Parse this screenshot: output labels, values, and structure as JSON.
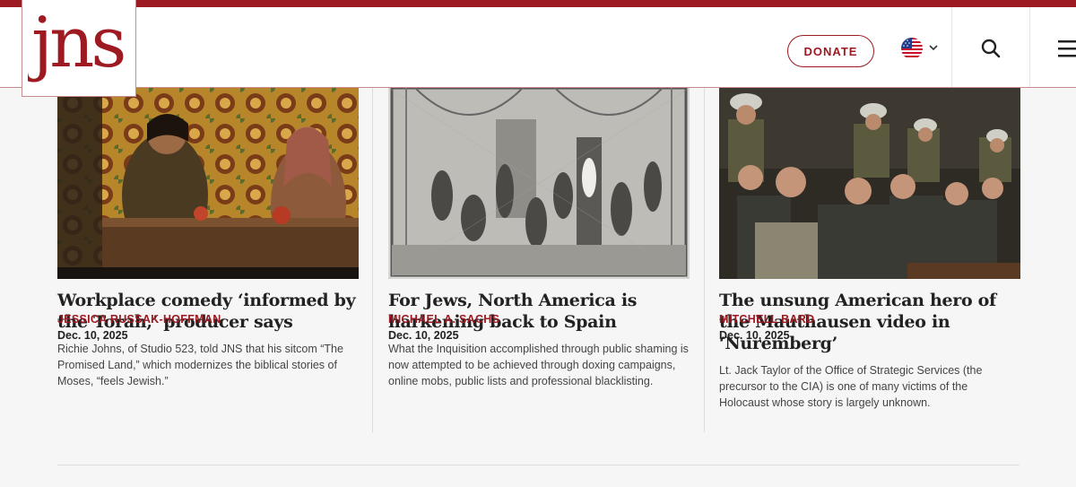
{
  "brand": {
    "logo_text": "jns",
    "accent_color": "#9e1a22"
  },
  "header": {
    "donate_label": "DONATE",
    "language_flag": "us-flag-icon",
    "icons": [
      "chevron-down-icon",
      "search-icon",
      "menu-icon"
    ]
  },
  "articles": [
    {
      "title": "Workplace comedy ‘informed by the Torah,’ producer says",
      "summary": "Richie Johns, of Studio 523, told JNS that his sitcom “The Promised Land,” which modernizes the biblical stories of Moses, “feels Jewish.”",
      "author": "JESSICA RUSSAK-HOFFMAN",
      "date": "Dec. 10, 2025"
    },
    {
      "title": "For Jews, North America is harkening back to Spain",
      "summary": "What the Inquisition accomplished through public shaming is now attempted to be achieved through doxing campaigns, online mobs, public lists and professional blacklisting.",
      "author": "MICHAEL A. SACHS",
      "date": "Dec. 10, 2025"
    },
    {
      "title": "The unsung American hero of the Mauthausen video in ‘Nuremberg’",
      "summary": "Lt. Jack Taylor of the Office of Strategic Services (the precursor to the CIA) is one of many victims of the Holocaust whose story is largely unknown.",
      "author": "MITCHELL BARD",
      "date": "Dec. 10, 2025"
    }
  ]
}
